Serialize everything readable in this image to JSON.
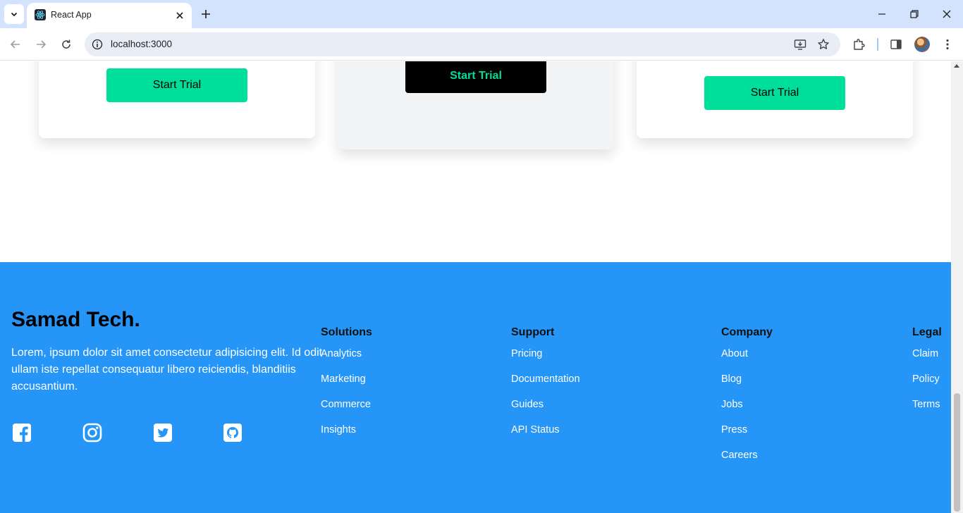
{
  "browser": {
    "tab_title": "React App",
    "url": "localhost:3000"
  },
  "cards": [
    {
      "button_label": "Start Trial"
    },
    {
      "button_label": "Start Trial"
    },
    {
      "button_label": "Start Trial"
    }
  ],
  "footer": {
    "brand": "Samad Tech.",
    "description": "Lorem, ipsum dolor sit amet consectetur adipisicing elit. Id odit ullam iste repellat consequatur libero reiciendis, blanditiis accusantium.",
    "social_icons": [
      "facebook-icon",
      "instagram-icon",
      "twitter-icon",
      "github-icon"
    ],
    "columns": [
      {
        "heading": "Solutions",
        "links": [
          "Analytics",
          "Marketing",
          "Commerce",
          "Insights"
        ]
      },
      {
        "heading": "Support",
        "links": [
          "Pricing",
          "Documentation",
          "Guides",
          "API Status"
        ]
      },
      {
        "heading": "Company",
        "links": [
          "About",
          "Blog",
          "Jobs",
          "Press",
          "Careers"
        ]
      },
      {
        "heading": "Legal",
        "links": [
          "Claim",
          "Policy",
          "Terms"
        ]
      }
    ]
  },
  "colors": {
    "footer_bg": "#2596f7",
    "accent_green": "#00df9a",
    "tabbar_bg": "#d3e3fd"
  }
}
